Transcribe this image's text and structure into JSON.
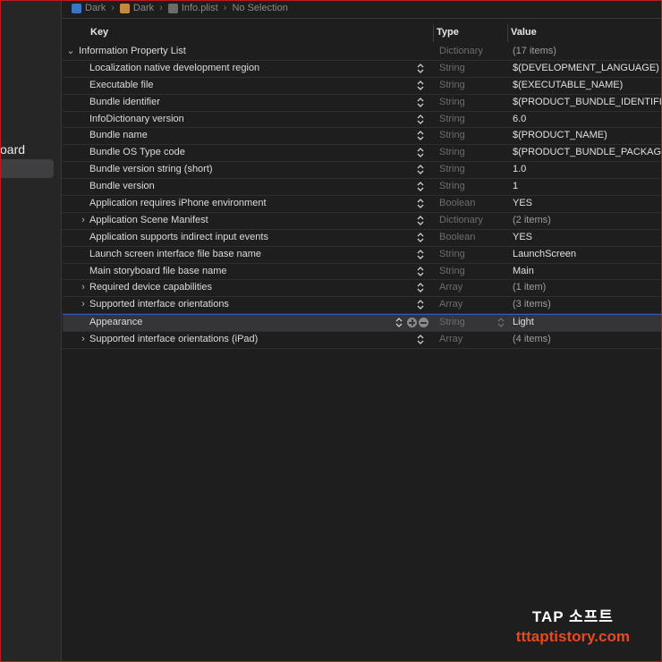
{
  "breadcrumb": [
    "Dark",
    "Dark",
    "Info.plist",
    "No Selection"
  ],
  "sidebar": {
    "label": "oard"
  },
  "columns": {
    "key": "Key",
    "type": "Type",
    "value": "Value"
  },
  "root": {
    "key": "Information Property List",
    "type": "Dictionary",
    "value": "(17 items)"
  },
  "rows": [
    {
      "key": "Localization native development region",
      "type": "String",
      "value": "$(DEVELOPMENT_LANGUAGE)",
      "expandable": false
    },
    {
      "key": "Executable file",
      "type": "String",
      "value": "$(EXECUTABLE_NAME)",
      "expandable": false
    },
    {
      "key": "Bundle identifier",
      "type": "String",
      "value": "$(PRODUCT_BUNDLE_IDENTIFI",
      "expandable": false
    },
    {
      "key": "InfoDictionary version",
      "type": "String",
      "value": "6.0",
      "expandable": false
    },
    {
      "key": "Bundle name",
      "type": "String",
      "value": "$(PRODUCT_NAME)",
      "expandable": false
    },
    {
      "key": "Bundle OS Type code",
      "type": "String",
      "value": "$(PRODUCT_BUNDLE_PACKAG",
      "expandable": false
    },
    {
      "key": "Bundle version string (short)",
      "type": "String",
      "value": "1.0",
      "expandable": false
    },
    {
      "key": "Bundle version",
      "type": "String",
      "value": "1",
      "expandable": false
    },
    {
      "key": "Application requires iPhone environment",
      "type": "Boolean",
      "value": "YES",
      "expandable": false
    },
    {
      "key": "Application Scene Manifest",
      "type": "Dictionary",
      "value": "(2 items)",
      "expandable": true
    },
    {
      "key": "Application supports indirect input events",
      "type": "Boolean",
      "value": "YES",
      "expandable": false
    },
    {
      "key": "Launch screen interface file base name",
      "type": "String",
      "value": "LaunchScreen",
      "expandable": false
    },
    {
      "key": "Main storyboard file base name",
      "type": "String",
      "value": "Main",
      "expandable": false
    },
    {
      "key": "Required device capabilities",
      "type": "Array",
      "value": "(1 item)",
      "expandable": true
    },
    {
      "key": "Supported interface orientations",
      "type": "Array",
      "value": "(3 items)",
      "expandable": true
    },
    {
      "key": "Appearance",
      "type": "String",
      "value": "Light",
      "expandable": false,
      "selected": true
    },
    {
      "key": "Supported interface orientations (iPad)",
      "type": "Array",
      "value": "(4 items)",
      "expandable": true
    }
  ],
  "watermark": {
    "line1": "TAP 소프트",
    "line2": "tttaptistory.com"
  }
}
